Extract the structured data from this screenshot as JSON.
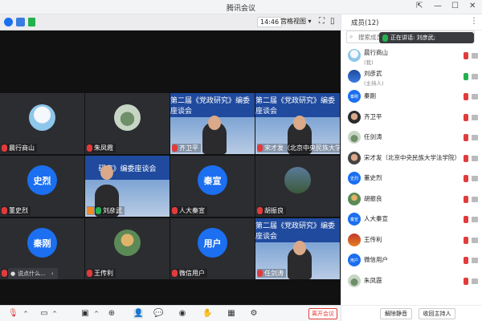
{
  "window": {
    "title": "腾讯会议",
    "controls": [
      "⇱",
      "—",
      "☐",
      "✕"
    ]
  },
  "meeting": {
    "time": "14:46",
    "view_label": "宫格视图",
    "tiles": [
      {
        "name": "晨行商山",
        "kind": "photo"
      },
      {
        "name": "朱凤霞",
        "kind": "photo"
      },
      {
        "name": "齐卫平",
        "kind": "video"
      },
      {
        "name": "宋才发（北京中央民族大学法学院",
        "kind": "video"
      },
      {
        "name": "董史烈",
        "kind": "text",
        "avatar_text": "史烈"
      },
      {
        "name": "刘彦武",
        "kind": "video"
      },
      {
        "name": "人大秦宣",
        "kind": "text",
        "avatar_text": "秦宣"
      },
      {
        "name": "胡振良",
        "kind": "photo"
      },
      {
        "name": "",
        "kind": "text",
        "avatar_text": "秦刚"
      },
      {
        "name": "王传利",
        "kind": "photo"
      },
      {
        "name": "微信用户",
        "kind": "text",
        "avatar_text": "用户"
      },
      {
        "name": "任剑涛",
        "kind": "video"
      }
    ],
    "banner_text": "第二届《党政研究》编委座谈会",
    "banner_text_short": "研究》编委座谈会",
    "chat_hint": "说点什么...",
    "leave_label": "离开会议"
  },
  "panel": {
    "title": "成员(12)",
    "search_placeholder": "搜索成员",
    "speaking_text": "正在讲话: 刘彦武;",
    "members": [
      {
        "name": "晨行商山",
        "sub": "(我)",
        "avatar": "",
        "mic": "red"
      },
      {
        "name": "刘彦武",
        "sub": "(主持人)",
        "avatar": "",
        "mic": "green"
      },
      {
        "name": "秦刚",
        "sub": "",
        "avatar": "秦刚",
        "mic": "red"
      },
      {
        "name": "齐卫平",
        "sub": "",
        "avatar": "",
        "mic": "red"
      },
      {
        "name": "任剑涛",
        "sub": "",
        "avatar": "",
        "mic": "red"
      },
      {
        "name": "宋才发（北京中央民族大学法学院）",
        "sub": "",
        "avatar": "",
        "mic": "red"
      },
      {
        "name": "董史烈",
        "sub": "",
        "avatar": "史烈",
        "mic": "red"
      },
      {
        "name": "胡振良",
        "sub": "",
        "avatar": "",
        "mic": "red"
      },
      {
        "name": "人大秦宣",
        "sub": "",
        "avatar": "秦宣",
        "mic": "red"
      },
      {
        "name": "王传利",
        "sub": "",
        "avatar": "",
        "mic": "red"
      },
      {
        "name": "微信用户",
        "sub": "",
        "avatar": "用户",
        "mic": "red"
      },
      {
        "name": "朱凤霞",
        "sub": "",
        "avatar": "",
        "mic": "red"
      }
    ],
    "unmute_label": "解除静音",
    "reclaim_host_label": "收回主持人"
  },
  "colors": {
    "accent": "#1b6ff0",
    "danger": "#e23b3b",
    "ok": "#23b14d"
  }
}
